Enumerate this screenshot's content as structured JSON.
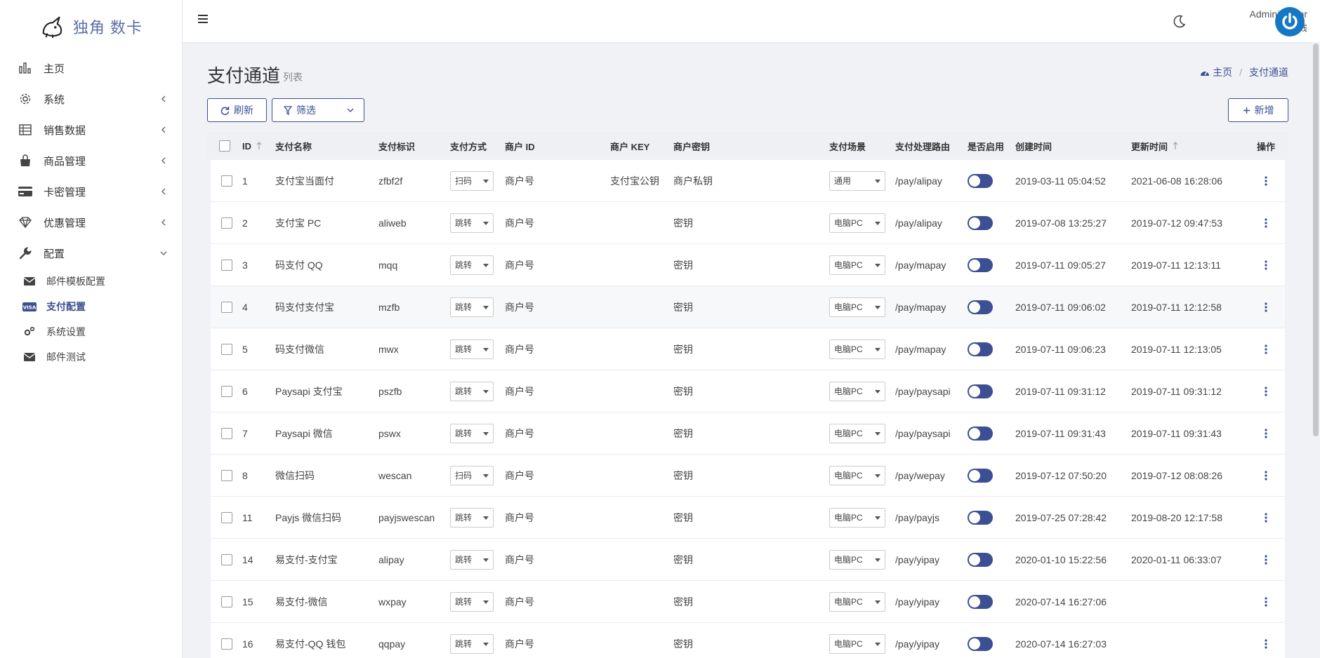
{
  "brand": {
    "name": "独角 数卡"
  },
  "sidebar": {
    "items": [
      {
        "label": "主页",
        "icon": "bar-chart-icon",
        "chevron": "none"
      },
      {
        "label": "系统",
        "icon": "gear-icon",
        "chevron": "left"
      },
      {
        "label": "销售数据",
        "icon": "table-icon",
        "chevron": "left"
      },
      {
        "label": "商品管理",
        "icon": "shopping-bag-icon",
        "chevron": "left"
      },
      {
        "label": "卡密管理",
        "icon": "credit-card-icon",
        "chevron": "left"
      },
      {
        "label": "优惠管理",
        "icon": "diamond-icon",
        "chevron": "left"
      },
      {
        "label": "配置",
        "icon": "wrench-icon",
        "chevron": "down"
      }
    ],
    "subitems": [
      {
        "label": "邮件模板配置",
        "icon": "envelope-icon"
      },
      {
        "label": "支付配置",
        "icon": "visa-card-icon",
        "active": true
      },
      {
        "label": "系统设置",
        "icon": "cogs-icon"
      },
      {
        "label": "邮件测试",
        "icon": "envelope-icon"
      }
    ]
  },
  "header": {
    "user_name": "Administrator",
    "user_status": "在线",
    "status_color": "#28a745"
  },
  "page": {
    "title": "支付通道",
    "subtitle": "列表",
    "breadcrumb_home": "主页",
    "breadcrumb_current": "支付通道"
  },
  "toolbar": {
    "refresh_label": "刷新",
    "filter_label": "筛选",
    "add_label": "新增"
  },
  "colors": {
    "accent": "#3c4f93"
  },
  "table": {
    "headers": {
      "id": "ID",
      "name": "支付名称",
      "ident": "支付标识",
      "way": "支付方式",
      "merchant_id": "商户 ID",
      "merchant_key": "商户 KEY",
      "merchant_secret": "商户密钥",
      "scene": "支付场景",
      "route": "支付处理路由",
      "enabled": "是否启用",
      "created": "创建时间",
      "updated": "更新时间",
      "ops": "操作"
    },
    "rows": [
      {
        "id": "1",
        "name": "支付宝当面付",
        "ident": "zfbf2f",
        "way": "扫码",
        "merchant_id": "商户号",
        "merchant_key": "支付宝公钥",
        "merchant_secret": "商户私钥",
        "scene": "通用",
        "route": "/pay/alipay",
        "created": "2019-03-11 05:04:52",
        "updated": "2021-06-08 16:28:06"
      },
      {
        "id": "2",
        "name": "支付宝 PC",
        "ident": "aliweb",
        "way": "跳转",
        "merchant_id": "商户号",
        "merchant_key": "",
        "merchant_secret": "密钥",
        "scene": "电脑PC",
        "route": "/pay/alipay",
        "created": "2019-07-08 13:25:27",
        "updated": "2019-07-12 09:47:53"
      },
      {
        "id": "3",
        "name": "码支付 QQ",
        "ident": "mqq",
        "way": "跳转",
        "merchant_id": "商户号",
        "merchant_key": "",
        "merchant_secret": "密钥",
        "scene": "电脑PC",
        "route": "/pay/mapay",
        "created": "2019-07-11 09:05:27",
        "updated": "2019-07-11 12:13:11"
      },
      {
        "id": "4",
        "name": "码支付支付宝",
        "ident": "mzfb",
        "way": "跳转",
        "merchant_id": "商户号",
        "merchant_key": "",
        "merchant_secret": "密钥",
        "scene": "电脑PC",
        "route": "/pay/mapay",
        "created": "2019-07-11 09:06:02",
        "updated": "2019-07-11 12:12:58"
      },
      {
        "id": "5",
        "name": "码支付微信",
        "ident": "mwx",
        "way": "跳转",
        "merchant_id": "商户号",
        "merchant_key": "",
        "merchant_secret": "密钥",
        "scene": "电脑PC",
        "route": "/pay/mapay",
        "created": "2019-07-11 09:06:23",
        "updated": "2019-07-11 12:13:05"
      },
      {
        "id": "6",
        "name": "Paysapi 支付宝",
        "ident": "pszfb",
        "way": "跳转",
        "merchant_id": "商户号",
        "merchant_key": "",
        "merchant_secret": "密钥",
        "scene": "电脑PC",
        "route": "/pay/paysapi",
        "created": "2019-07-11 09:31:12",
        "updated": "2019-07-11 09:31:12"
      },
      {
        "id": "7",
        "name": "Paysapi 微信",
        "ident": "pswx",
        "way": "跳转",
        "merchant_id": "商户号",
        "merchant_key": "",
        "merchant_secret": "密钥",
        "scene": "电脑PC",
        "route": "/pay/paysapi",
        "created": "2019-07-11 09:31:43",
        "updated": "2019-07-11 09:31:43"
      },
      {
        "id": "8",
        "name": "微信扫码",
        "ident": "wescan",
        "way": "扫码",
        "merchant_id": "商户号",
        "merchant_key": "",
        "merchant_secret": "密钥",
        "scene": "电脑PC",
        "route": "/pay/wepay",
        "created": "2019-07-12 07:50:20",
        "updated": "2019-07-12 08:08:26"
      },
      {
        "id": "11",
        "name": "Payjs 微信扫码",
        "ident": "payjswescan",
        "way": "跳转",
        "merchant_id": "商户号",
        "merchant_key": "",
        "merchant_secret": "密钥",
        "scene": "电脑PC",
        "route": "/pay/payjs",
        "created": "2019-07-25 07:28:42",
        "updated": "2019-08-20 12:17:58"
      },
      {
        "id": "14",
        "name": "易支付-支付宝",
        "ident": "alipay",
        "way": "跳转",
        "merchant_id": "商户号",
        "merchant_key": "",
        "merchant_secret": "密钥",
        "scene": "电脑PC",
        "route": "/pay/yipay",
        "created": "2020-01-10 15:22:56",
        "updated": "2020-01-11 06:33:07"
      },
      {
        "id": "15",
        "name": "易支付-微信",
        "ident": "wxpay",
        "way": "跳转",
        "merchant_id": "商户号",
        "merchant_key": "",
        "merchant_secret": "密钥",
        "scene": "电脑PC",
        "route": "/pay/yipay",
        "created": "2020-07-14 16:27:06",
        "updated": ""
      },
      {
        "id": "16",
        "name": "易支付-QQ 钱包",
        "ident": "qqpay",
        "way": "跳转",
        "merchant_id": "商户号",
        "merchant_key": "",
        "merchant_secret": "密钥",
        "scene": "电脑PC",
        "route": "/pay/yipay",
        "created": "2020-07-14 16:27:03",
        "updated": ""
      }
    ]
  }
}
